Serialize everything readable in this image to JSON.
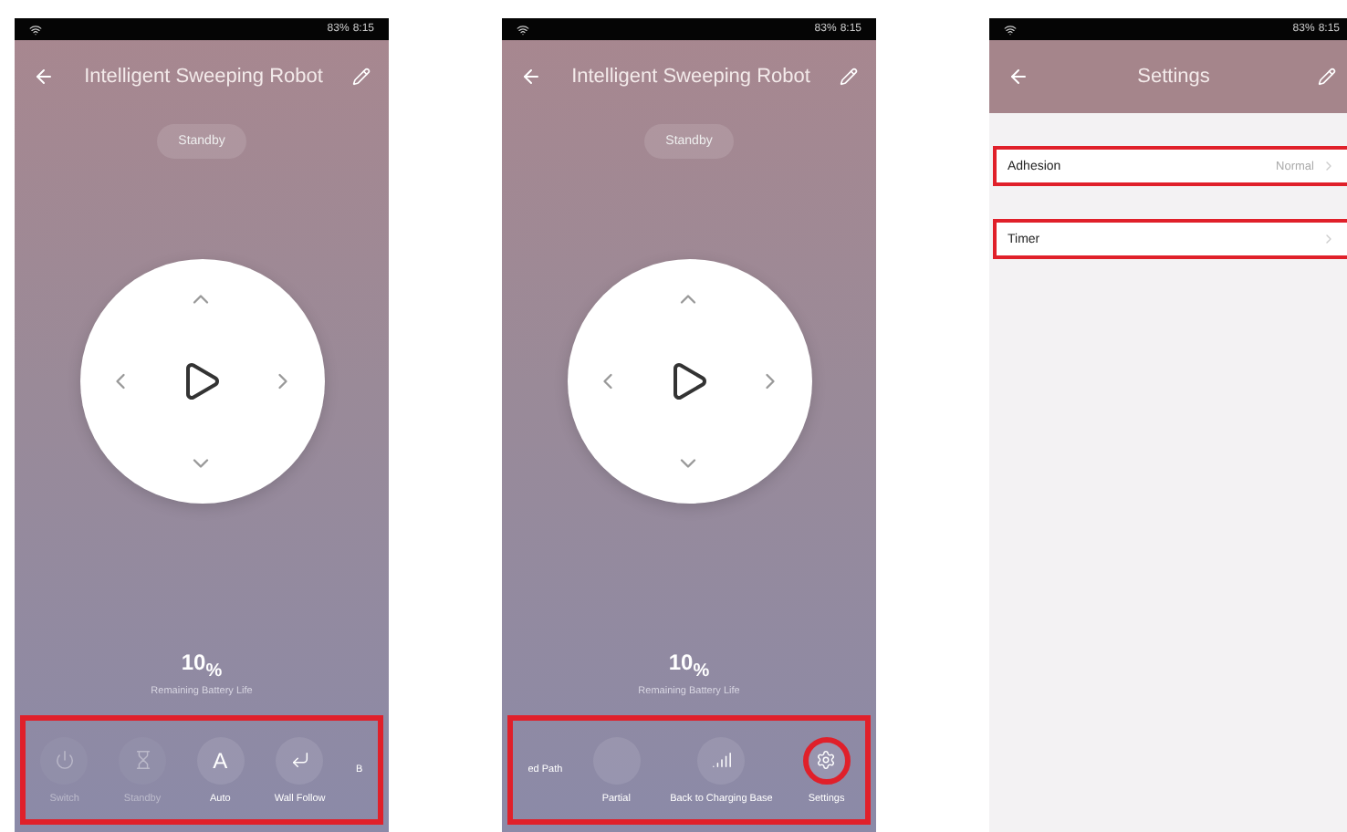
{
  "phones": [
    {
      "kind": "control",
      "status_bar": {
        "battery": "83%",
        "time": "8:15"
      },
      "header": {
        "title": "Intelligent Sweeping Robot"
      },
      "state_pill": "Standby",
      "battery": {
        "value": "10$_{%}$",
        "label": "Remaining Battery Life"
      },
      "action_bar": {
        "highlighted": true,
        "items": [
          {
            "label": "Switch",
            "kind": "power",
            "disabled": true
          },
          {
            "label": "Standby",
            "kind": "hourglass",
            "disabled": true
          },
          {
            "label": "Auto",
            "kind": "glyph",
            "glyph": "A",
            "disabled": false
          },
          {
            "label": "Wall Follow",
            "kind": "wallfollow",
            "disabled": false
          },
          {
            "label": "B",
            "kind": "none",
            "disabled": false
          }
        ]
      }
    },
    {
      "kind": "control",
      "status_bar": {
        "battery": "83%",
        "time": "8:15"
      },
      "header": {
        "title": "Intelligent Sweeping Robot"
      },
      "state_pill": "Standby",
      "battery": {
        "value": "10$_{%}$",
        "label": "Remaining Battery Life"
      },
      "action_bar": {
        "highlighted": true,
        "items": [
          {
            "label": "ed Path",
            "kind": "none",
            "disabled": false
          },
          {
            "label": "Partial",
            "kind": "blank",
            "disabled": false
          },
          {
            "label": "Back to Charging Base",
            "kind": "charge",
            "disabled": false
          },
          {
            "label": "Settings",
            "kind": "gear",
            "disabled": false,
            "circled": true
          }
        ]
      }
    },
    {
      "kind": "settings",
      "status_bar": {
        "battery": "83%",
        "time": "8:15"
      },
      "header": {
        "title": "Settings"
      },
      "rows": [
        {
          "label": "Adhesion",
          "value": "Normal",
          "highlighted": true
        },
        {
          "label": "Timer",
          "highlighted": true
        }
      ]
    }
  ]
}
